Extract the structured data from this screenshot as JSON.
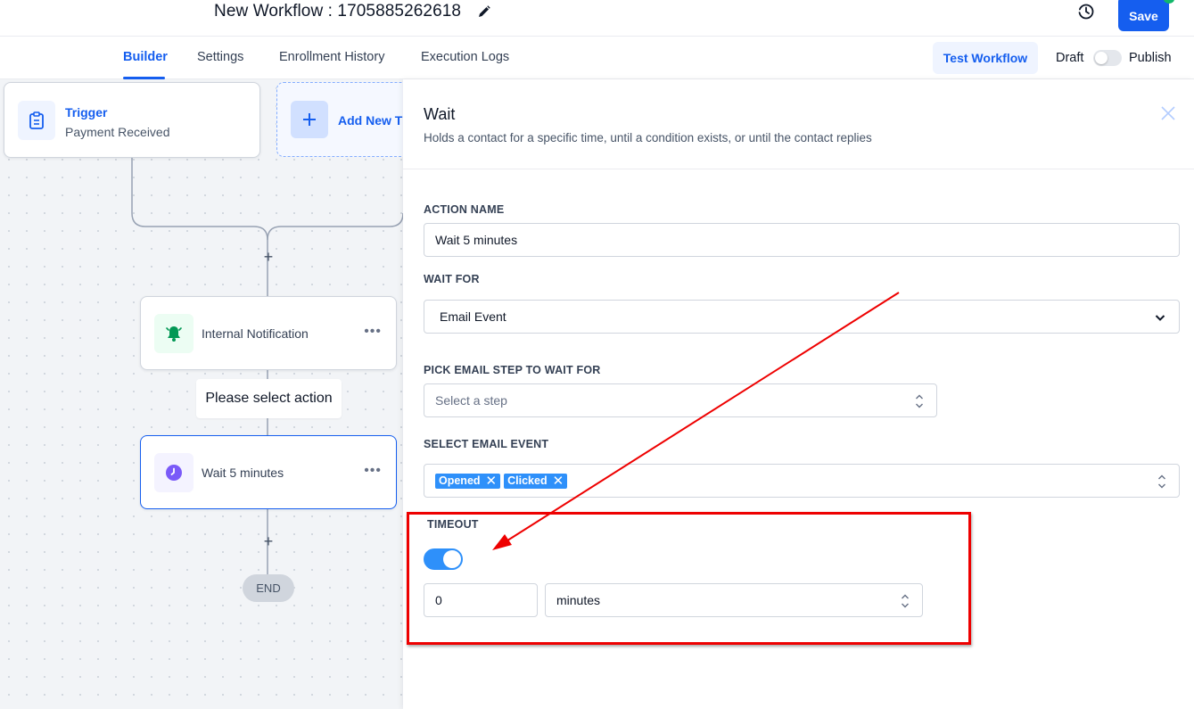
{
  "header": {
    "workflow_title": "New Workflow : 1705885262618",
    "save_label": "Save"
  },
  "tabs": [
    {
      "label": "Builder",
      "active": true
    },
    {
      "label": "Settings"
    },
    {
      "label": "Enrollment History"
    },
    {
      "label": "Execution Logs"
    }
  ],
  "toolbar": {
    "test_workflow_label": "Test Workflow",
    "draft_label": "Draft",
    "publish_label": "Publish",
    "published": false
  },
  "canvas": {
    "trigger": {
      "title": "Trigger",
      "subtitle": "Payment Received"
    },
    "add_trigger_label": "Add New T",
    "actions": [
      {
        "label": "Internal Notification",
        "icon": "bell-icon"
      },
      {
        "label": "Wait 5 minutes",
        "icon": "clock-icon"
      }
    ],
    "tooltip": "Please select action",
    "end_label": "END"
  },
  "panel": {
    "title": "Wait",
    "description": "Holds a contact for a specific time, until a condition exists, or until the contact replies",
    "action_name_label": "ACTION NAME",
    "action_name_value": "Wait 5 minutes",
    "wait_for_label": "WAIT FOR",
    "wait_for_value": "Email Event",
    "pick_step_label": "PICK EMAIL STEP TO WAIT FOR",
    "pick_step_placeholder": "Select a step",
    "email_event_label": "SELECT EMAIL EVENT",
    "email_events": [
      "Opened",
      "Clicked"
    ],
    "timeout_label": "TIMEOUT",
    "timeout_enabled": true,
    "timeout_value": "0",
    "timeout_unit": "minutes"
  },
  "colors": {
    "primary": "#155eef",
    "annotation": "#ee0000",
    "chip": "#2e90fa"
  }
}
